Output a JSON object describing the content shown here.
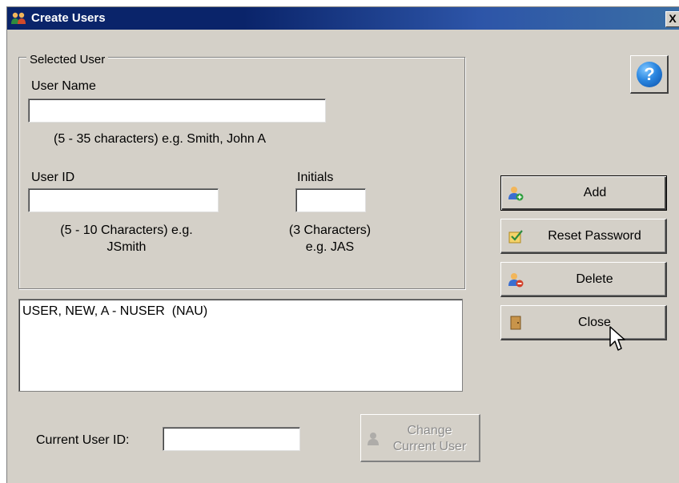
{
  "window": {
    "title": "Create Users",
    "close_glyph": "X"
  },
  "selected_user": {
    "legend": "Selected User",
    "user_name_label": "User Name",
    "user_name_value": "",
    "user_name_hint": "(5 - 35 characters) e.g. Smith, John A",
    "user_id_label": "User ID",
    "user_id_value": "",
    "user_id_hint_line1": "(5 - 10 Characters) e.g.",
    "user_id_hint_line2": "JSmith",
    "initials_label": "Initials",
    "initials_value": "",
    "initials_hint_line1": "(3 Characters)",
    "initials_hint_line2": "e.g. JAS"
  },
  "users_list": {
    "items": [
      "USER, NEW, A - NUSER  (NAU)"
    ]
  },
  "buttons": {
    "help_glyph": "?",
    "add": "Add",
    "reset_password": "Reset Password",
    "delete": "Delete",
    "close": "Close",
    "change_line1": "Change",
    "change_line2": "Current User"
  },
  "current_user": {
    "label": "Current User ID:",
    "value": ""
  },
  "icons": {
    "title": "users-icon",
    "add": "user-add-icon",
    "reset": "password-reset-icon",
    "delete": "user-delete-icon",
    "close": "door-icon",
    "change": "user-switch-icon",
    "help": "help-icon"
  },
  "colors": {
    "titlebar": "#0a246a",
    "face": "#d4d0c8",
    "help_blue": "#2a86e0"
  }
}
